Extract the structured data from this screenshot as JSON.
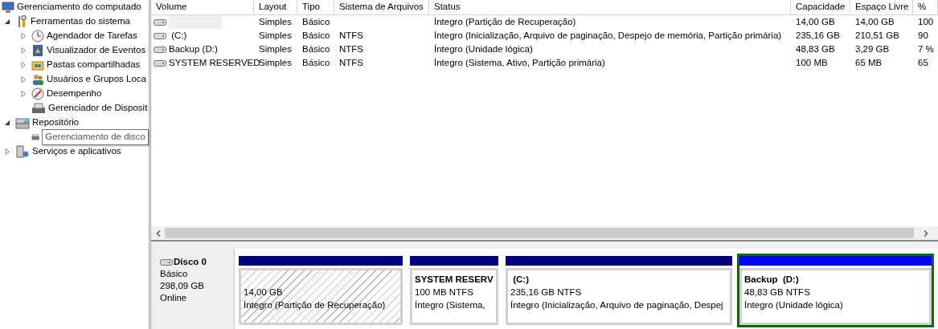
{
  "tree": {
    "label": "Gerenciamento do computado",
    "children": [
      {
        "label": "Ferramentas do sistema",
        "kind": "node",
        "expanded": true,
        "children": [
          {
            "label": "Agendador de Tarefas",
            "kind": "node",
            "expanded": false
          },
          {
            "label": "Visualizador de Eventos",
            "kind": "node",
            "expanded": false
          },
          {
            "label": "Pastas compartilhadas",
            "kind": "node",
            "expanded": false
          },
          {
            "label": "Usuários e Grupos Loca",
            "kind": "node",
            "expanded": false
          },
          {
            "label": "Desempenho",
            "kind": "node",
            "expanded": false
          },
          {
            "label": "Gerenciador de Disposit",
            "kind": "leaf"
          }
        ]
      },
      {
        "label": "Repositório",
        "kind": "node",
        "expanded": true,
        "children": [
          {
            "label": "Gerenciamento de disco",
            "kind": "leaf",
            "tooltip": true
          }
        ]
      },
      {
        "label": "Serviços e aplicativos",
        "kind": "node",
        "expanded": false
      }
    ]
  },
  "table": {
    "columns": [
      "Volume",
      "Layout",
      "Tipo",
      "Sistema de Arquivos",
      "Status",
      "Capacidade",
      "Espaço Livre",
      "%"
    ],
    "rows": [
      {
        "volume": "",
        "redacted": true,
        "layout": "Simples",
        "tipo": "Básico",
        "fs": "",
        "status": "Íntegro (Partição de Recuperação)",
        "capacity": "14,00 GB",
        "free": "14,00 GB",
        "pct": "100"
      },
      {
        "volume": " (C:)",
        "redacted": false,
        "layout": "Simples",
        "tipo": "Básico",
        "fs": "NTFS",
        "status": "Íntegro (Inicialização, Arquivo de paginação, Despejo de memória, Partição primária)",
        "capacity": "235,16 GB",
        "free": "210,51 GB",
        "pct": "90"
      },
      {
        "volume": "Backup (D:)",
        "redacted": false,
        "layout": "Simples",
        "tipo": "Básico",
        "fs": "NTFS",
        "status": "Íntegro (Unidade lógica)",
        "capacity": "48,83 GB",
        "free": "3,29 GB",
        "pct": "7 %"
      },
      {
        "volume": "SYSTEM RESERVED",
        "redacted": false,
        "layout": "Simples",
        "tipo": "Básico",
        "fs": "NTFS",
        "status": "Íntegro (Sistema, Ativo, Partição primária)",
        "capacity": "100 MB",
        "free": "65 MB",
        "pct": "65"
      }
    ]
  },
  "disk": {
    "name": "Disco 0",
    "type": "Básico",
    "size": "298,09 GB",
    "state": "Online",
    "partitions": [
      {
        "size": "14,00 GB",
        "status": "Íntegro (Partição de Recuperação)",
        "color": "#000080",
        "hatched": true,
        "selected": false
      },
      {
        "name": "SYSTEM RESERV",
        "size": "100 MB NTFS",
        "status": "Íntegro (Sistema,",
        "color": "#000080",
        "hatched": false,
        "selected": false
      },
      {
        "name": " (C:)",
        "size": "235,16 GB NTFS",
        "status": "Íntegro (Inicialização, Arquivo de paginação, Despej",
        "color": "#000080",
        "hatched": false,
        "selected": false
      },
      {
        "name": "Backup  (D:)",
        "size": "48,83 GB NTFS",
        "status": "Íntegro (Unidade lógica)",
        "color": "#0000ff",
        "hatched": false,
        "selected": true
      }
    ]
  }
}
